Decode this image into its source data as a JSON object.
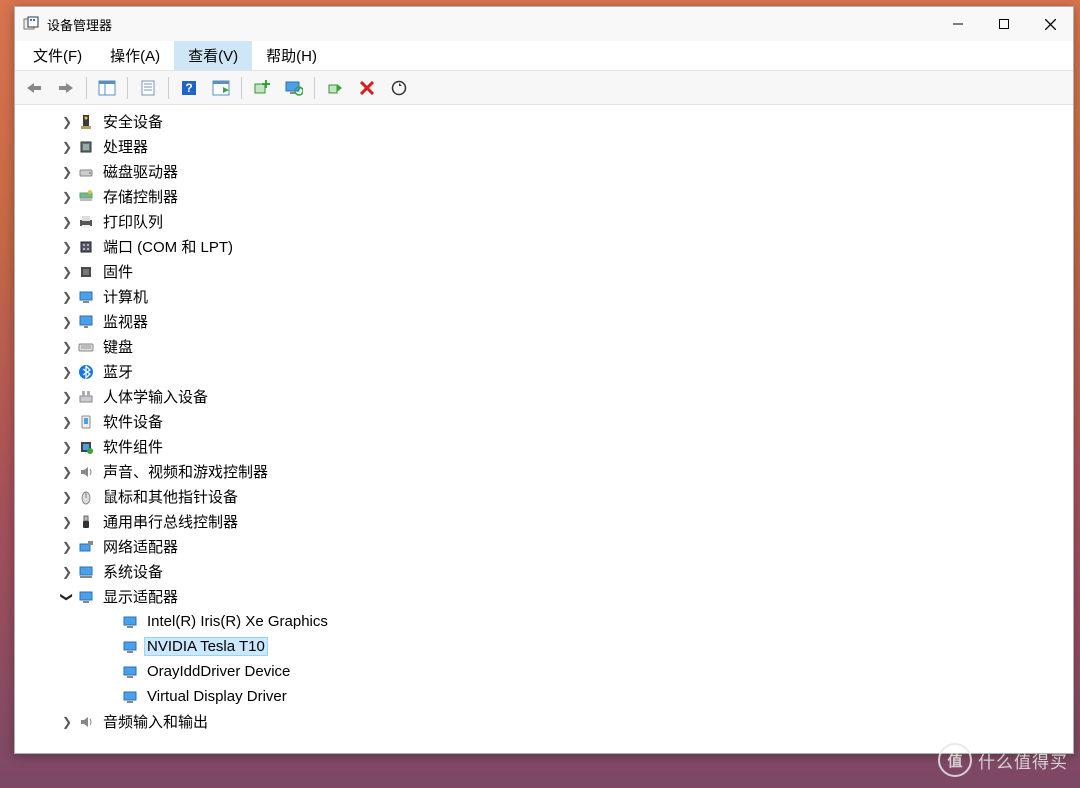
{
  "window": {
    "title": "设备管理器"
  },
  "menu": {
    "file": "文件(F)",
    "action": "操作(A)",
    "view": "查看(V)",
    "help": "帮助(H)"
  },
  "tree": {
    "security_devices": "安全设备",
    "processors": "处理器",
    "disk_drives": "磁盘驱动器",
    "storage_controllers": "存储控制器",
    "print_queues": "打印队列",
    "ports": "端口 (COM 和 LPT)",
    "firmware": "固件",
    "computer": "计算机",
    "monitors": "监视器",
    "keyboards": "键盘",
    "bluetooth": "蓝牙",
    "hid": "人体学输入设备",
    "software_devices": "软件设备",
    "software_components": "软件组件",
    "sound_video_game": "声音、视频和游戏控制器",
    "mice": "鼠标和其他指针设备",
    "usb": "通用串行总线控制器",
    "network_adapters": "网络适配器",
    "system_devices": "系统设备",
    "display_adapters": "显示适配器",
    "display_children": {
      "iris": "Intel(R) Iris(R) Xe Graphics",
      "tesla": "NVIDIA Tesla T10",
      "oray": "OrayIddDriver Device",
      "virtual": "Virtual Display Driver"
    },
    "audio_io": "音频输入和输出"
  },
  "watermark": {
    "badge": "值",
    "text": "什么值得买"
  }
}
